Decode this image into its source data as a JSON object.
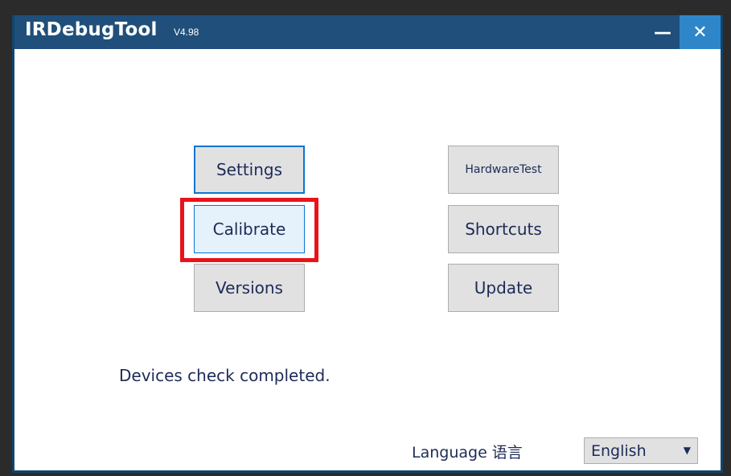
{
  "titlebar": {
    "title": "IRDebugTool",
    "version": "V4.98",
    "minimize_glyph": "—",
    "close_glyph": "✕"
  },
  "buttons": {
    "settings": "Settings",
    "calibrate": "Calibrate",
    "versions": "Versions",
    "hardware_test": "HardwareTest",
    "shortcuts": "Shortcuts",
    "update": "Update"
  },
  "status_text": "Devices check completed.",
  "language": {
    "label": "Language 语言",
    "selected": "English",
    "arrow_icon": "▼"
  },
  "colors": {
    "titlebar": "#1f4f7a",
    "close_button": "#2e86c9",
    "highlight": "#e8131b",
    "text": "#1d2b57"
  }
}
